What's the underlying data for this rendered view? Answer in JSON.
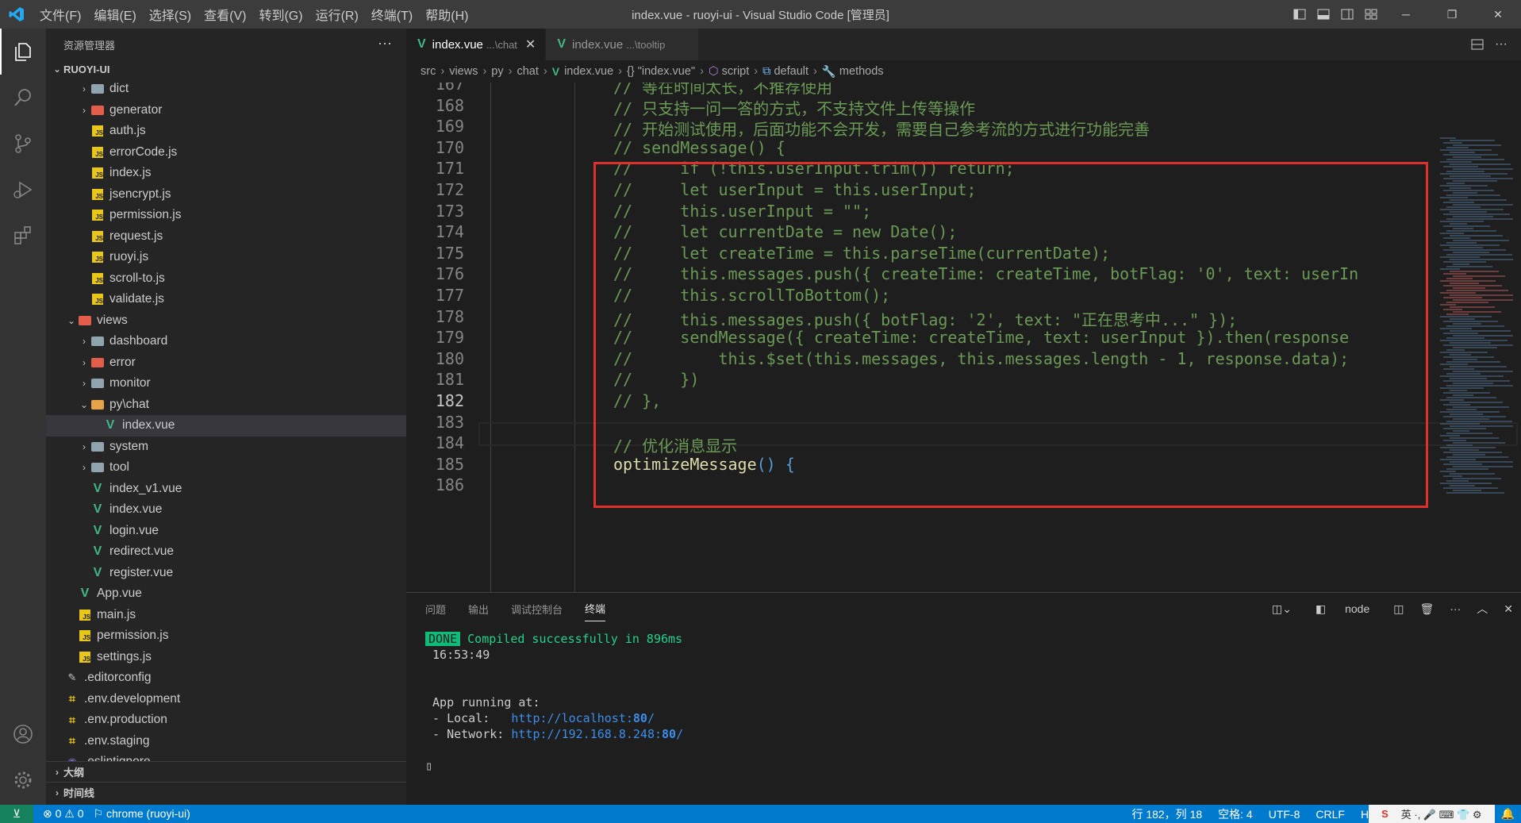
{
  "titlebar": {
    "menu": [
      "文件(F)",
      "编辑(E)",
      "选择(S)",
      "查看(V)",
      "转到(G)",
      "运行(R)",
      "终端(T)",
      "帮助(H)"
    ],
    "title": "index.vue - ruoyi-ui - Visual Studio Code [管理员]"
  },
  "sidebar": {
    "header": "资源管理器",
    "more": "···",
    "root": "RUOYI-UI",
    "tree": [
      {
        "label": "dict",
        "type": "folder",
        "depth": 2,
        "chev": "›"
      },
      {
        "label": "generator",
        "type": "folder-red",
        "depth": 2,
        "chev": "›"
      },
      {
        "label": "auth.js",
        "type": "js",
        "depth": 2,
        "chev": ""
      },
      {
        "label": "errorCode.js",
        "type": "js",
        "depth": 2,
        "chev": ""
      },
      {
        "label": "index.js",
        "type": "js",
        "depth": 2,
        "chev": ""
      },
      {
        "label": "jsencrypt.js",
        "type": "js",
        "depth": 2,
        "chev": ""
      },
      {
        "label": "permission.js",
        "type": "js",
        "depth": 2,
        "chev": ""
      },
      {
        "label": "request.js",
        "type": "js",
        "depth": 2,
        "chev": ""
      },
      {
        "label": "ruoyi.js",
        "type": "js",
        "depth": 2,
        "chev": ""
      },
      {
        "label": "scroll-to.js",
        "type": "js",
        "depth": 2,
        "chev": ""
      },
      {
        "label": "validate.js",
        "type": "js",
        "depth": 2,
        "chev": ""
      },
      {
        "label": "views",
        "type": "folder-red",
        "depth": 1,
        "chev": "⌄"
      },
      {
        "label": "dashboard",
        "type": "folder",
        "depth": 2,
        "chev": "›"
      },
      {
        "label": "error",
        "type": "folder-red",
        "depth": 2,
        "chev": "›"
      },
      {
        "label": "monitor",
        "type": "folder",
        "depth": 2,
        "chev": "›"
      },
      {
        "label": "py\\chat",
        "type": "folder-open",
        "depth": 2,
        "chev": "⌄"
      },
      {
        "label": "index.vue",
        "type": "vue",
        "depth": 3,
        "chev": "",
        "selected": true
      },
      {
        "label": "system",
        "type": "folder",
        "depth": 2,
        "chev": "›"
      },
      {
        "label": "tool",
        "type": "folder",
        "depth": 2,
        "chev": "›"
      },
      {
        "label": "index_v1.vue",
        "type": "vue",
        "depth": 2,
        "chev": ""
      },
      {
        "label": "index.vue",
        "type": "vue",
        "depth": 2,
        "chev": ""
      },
      {
        "label": "login.vue",
        "type": "vue",
        "depth": 2,
        "chev": ""
      },
      {
        "label": "redirect.vue",
        "type": "vue",
        "depth": 2,
        "chev": ""
      },
      {
        "label": "register.vue",
        "type": "vue",
        "depth": 2,
        "chev": ""
      },
      {
        "label": "App.vue",
        "type": "vue",
        "depth": 1,
        "chev": ""
      },
      {
        "label": "main.js",
        "type": "js",
        "depth": 1,
        "chev": ""
      },
      {
        "label": "permission.js",
        "type": "js",
        "depth": 1,
        "chev": ""
      },
      {
        "label": "settings.js",
        "type": "js",
        "depth": 1,
        "chev": ""
      },
      {
        "label": ".editorconfig",
        "type": "cfg",
        "depth": 0,
        "chev": ""
      },
      {
        "label": ".env.development",
        "type": "env",
        "depth": 0,
        "chev": ""
      },
      {
        "label": ".env.production",
        "type": "env",
        "depth": 0,
        "chev": ""
      },
      {
        "label": ".env.staging",
        "type": "env",
        "depth": 0,
        "chev": ""
      },
      {
        "label": ".eslintignore",
        "type": "eslint",
        "depth": 0,
        "chev": ""
      }
    ],
    "outline": "大纲",
    "timeline": "时间线"
  },
  "tabs": [
    {
      "label": "index.vue",
      "desc": "...\\chat",
      "active": true,
      "close": "✕"
    },
    {
      "label": "index.vue",
      "desc": "...\\tooltip",
      "active": false,
      "close": ""
    }
  ],
  "breadcrumb": [
    "src",
    "views",
    "py",
    "chat",
    "index.vue",
    "{} \"index.vue\"",
    "script",
    "default",
    "methods"
  ],
  "code": {
    "current_line": 182,
    "lines": [
      {
        "n": 167,
        "indent": 0,
        "parts": [
          {
            "t": "// 等在时间太长，不推荐使用",
            "c": "cm"
          }
        ]
      },
      {
        "n": 168,
        "indent": 0,
        "parts": [
          {
            "t": "// 只支持一问一答的方式，不支持文件上传等操作",
            "c": "cm"
          }
        ]
      },
      {
        "n": 169,
        "indent": 0,
        "parts": [
          {
            "t": "// 开始测试使用，后面功能不会开发，需要自己参考流的方式进行功能完善",
            "c": "cm"
          }
        ]
      },
      {
        "n": 170,
        "indent": 0,
        "parts": [
          {
            "t": "// sendMessage() {",
            "c": "cm"
          }
        ]
      },
      {
        "n": 171,
        "indent": 0,
        "parts": [
          {
            "t": "//     if (!this.userInput.trim()) return;",
            "c": "cm"
          }
        ]
      },
      {
        "n": 172,
        "indent": 0,
        "parts": [
          {
            "t": "//     let userInput = this.userInput;",
            "c": "cm"
          }
        ]
      },
      {
        "n": 173,
        "indent": 0,
        "parts": [
          {
            "t": "//     this.userInput = \"\";",
            "c": "cm"
          }
        ]
      },
      {
        "n": 174,
        "indent": 0,
        "parts": [
          {
            "t": "//     let currentDate = new Date();",
            "c": "cm"
          }
        ]
      },
      {
        "n": 175,
        "indent": 0,
        "parts": [
          {
            "t": "//     let createTime = this.parseTime(currentDate);",
            "c": "cm"
          }
        ]
      },
      {
        "n": 176,
        "indent": 0,
        "parts": [
          {
            "t": "//     this.messages.push({ createTime: createTime, botFlag: '0', text: userIn",
            "c": "cm"
          }
        ]
      },
      {
        "n": 177,
        "indent": 0,
        "parts": [
          {
            "t": "//     this.scrollToBottom();",
            "c": "cm"
          }
        ]
      },
      {
        "n": 178,
        "indent": 0,
        "parts": [
          {
            "t": "//     this.messages.push({ botFlag: '2', text: \"正在思考中...\" });",
            "c": "cm"
          }
        ]
      },
      {
        "n": 179,
        "indent": 0,
        "parts": [
          {
            "t": "//     sendMessage({ createTime: createTime, text: userInput }).then(response",
            "c": "cm"
          }
        ]
      },
      {
        "n": 180,
        "indent": 0,
        "parts": [
          {
            "t": "//         this.$set(this.messages, this.messages.length - 1, response.data);",
            "c": "cm"
          }
        ]
      },
      {
        "n": 181,
        "indent": 0,
        "parts": [
          {
            "t": "//     })",
            "c": "cm"
          }
        ]
      },
      {
        "n": 182,
        "indent": 0,
        "parts": [
          {
            "t": "// },",
            "c": "cm"
          }
        ]
      },
      {
        "n": 183,
        "indent": 0,
        "parts": []
      },
      {
        "n": 184,
        "indent": 0,
        "parts": [
          {
            "t": "// 优化消息显示",
            "c": "cm"
          }
        ]
      },
      {
        "n": 185,
        "indent": 0,
        "parts": [
          {
            "t": "optimizeMessage",
            "c": "fn"
          },
          {
            "t": "() ",
            "c": "pn"
          },
          {
            "t": "{",
            "c": "pn"
          }
        ]
      },
      {
        "n": 186,
        "indent": 0,
        "parts": []
      }
    ]
  },
  "panel": {
    "tabs": [
      "问题",
      "输出",
      "调试控制台",
      "终端"
    ],
    "active_tab": "终端",
    "terminal_name": "node",
    "done_badge": "DONE",
    "compiled": "Compiled successfully in 896ms",
    "time": "16:53:49",
    "running": "App running at:",
    "local_label": "- Local:   ",
    "local_url_prefix": "http://localhost:",
    "local_port": "80",
    "local_url_suffix": "/",
    "network_label": "- Network: ",
    "network_url_prefix": "http://192.168.8.248:",
    "network_port": "80",
    "network_url_suffix": "/",
    "cursor": "▯"
  },
  "statusbar": {
    "remote": "⊻",
    "problems": "⊗ 0 ⚠ 0",
    "debug": "chrome (ruoyi-ui)",
    "position": "行 182，列 18",
    "spaces": "空格: 4",
    "encoding": "UTF-8",
    "eol": "CRLF",
    "lang": "H",
    "ime": "英 ·, 🎤 ⌨ 👕 ⚙"
  },
  "colors": {
    "accent": "#007acc",
    "highlight_box": "#e0302c",
    "comment": "#6a9955",
    "done": "#0dbc79"
  }
}
